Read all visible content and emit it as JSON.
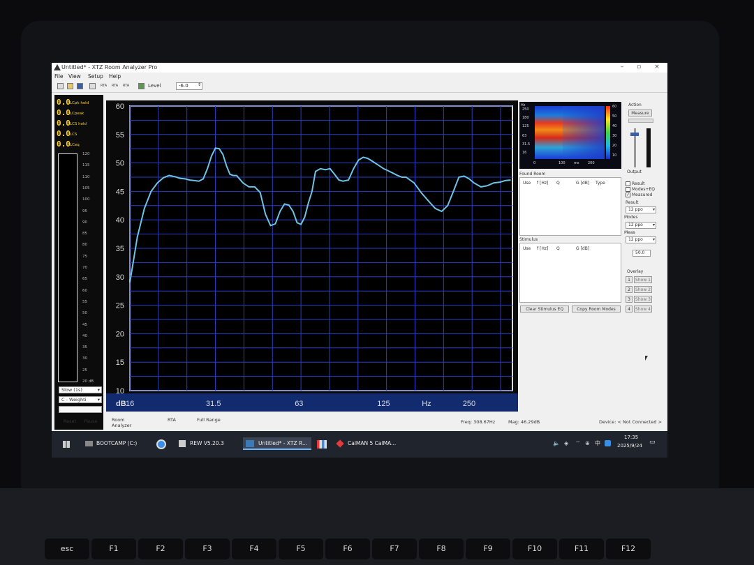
{
  "window": {
    "title": "Untitled* - XTZ Room Analyzer Pro"
  },
  "menu": [
    "File",
    "View",
    "Setup",
    "Help"
  ],
  "toolbar": {
    "level_label": "Level",
    "level_value": "-6.0",
    "small_labels": [
      "RTA",
      "RTA",
      "RTA"
    ]
  },
  "levels": [
    {
      "value": "0.0",
      "label": "LCpk hold"
    },
    {
      "value": "0.0",
      "label": "LCpeak"
    },
    {
      "value": "0.0",
      "label": "LCS hold"
    },
    {
      "value": "0.0",
      "label": "LCS"
    },
    {
      "value": "0.0",
      "label": "LCeq"
    }
  ],
  "meter_scale": [
    "120",
    "115",
    "110",
    "105",
    "100",
    "95",
    "90",
    "85",
    "80",
    "75",
    "70",
    "65",
    "60",
    "55",
    "50",
    "45",
    "40",
    "35",
    "30",
    "25",
    "20 dB"
  ],
  "left_controls": {
    "speed": "Slow (1s)",
    "weighting": "C - Weighti",
    "reset": "Reset",
    "pause": "Pause"
  },
  "chart_data": {
    "type": "line",
    "xscale": "log",
    "xlim": [
      16,
      355
    ],
    "ylim": [
      10,
      60
    ],
    "ylabel": "dB",
    "xlabel": "Hz",
    "yticks": [
      "10",
      "15",
      "20",
      "25",
      "30",
      "35",
      "40",
      "45",
      "50",
      "55",
      "60"
    ],
    "xtick_labels": [
      {
        "label": "16",
        "x": 16
      },
      {
        "label": "31.5",
        "x": 31.5
      },
      {
        "label": "63",
        "x": 63
      },
      {
        "label": "125",
        "x": 125
      },
      {
        "label": "Hz",
        "x": 177
      },
      {
        "label": "250",
        "x": 250
      }
    ],
    "grid": true,
    "series": [
      {
        "color": "#6fc3e6",
        "x": [
          16,
          16.5,
          17,
          18,
          19,
          20,
          21,
          22,
          23,
          24,
          25,
          26,
          27,
          28,
          29,
          30,
          31,
          32,
          33,
          34,
          35,
          36,
          37,
          38,
          40,
          42,
          44,
          46,
          48,
          50,
          52,
          54,
          56,
          58,
          60,
          62,
          64,
          66,
          68,
          70,
          72,
          75,
          78,
          81,
          84,
          87,
          90,
          94,
          98,
          102,
          106,
          110,
          115,
          120,
          125,
          130,
          135,
          140,
          145,
          150,
          160,
          170,
          180,
          190,
          200,
          210,
          220,
          230,
          240,
          250,
          260,
          275,
          290,
          305,
          320,
          335,
          350
        ],
        "y": [
          29,
          33,
          37,
          42,
          45,
          46.5,
          47.4,
          47.8,
          47.6,
          47.3,
          47.2,
          47,
          46.9,
          46.8,
          47.2,
          49,
          51.2,
          52.6,
          52.5,
          51.5,
          49.5,
          48,
          47.8,
          47.8,
          46.5,
          45.8,
          45.8,
          44.8,
          41,
          39,
          39.3,
          41.5,
          42.8,
          42.6,
          41.5,
          39.5,
          39.2,
          40.5,
          43,
          45,
          48.5,
          49,
          48.8,
          49,
          48,
          47,
          46.8,
          47,
          49,
          50.5,
          51,
          50.8,
          50.2,
          49.6,
          49,
          48.6,
          48.2,
          47.8,
          47.5,
          47.5,
          46.5,
          44.7,
          43.3,
          42,
          41.5,
          42.5,
          45,
          47.5,
          47.7,
          47.2,
          46.5,
          45.8,
          46,
          46.5,
          46.6,
          46.9,
          47
        ]
      }
    ]
  },
  "spectrogram": {
    "y_unit": "Hz",
    "y_ticks": [
      "250",
      "180",
      "125",
      "63",
      "31.5",
      "16"
    ],
    "right_ticks": [
      "60",
      "50",
      "40",
      "30",
      "20",
      "10"
    ],
    "x_ticks": [
      "0",
      "100",
      "ms",
      "200"
    ]
  },
  "right_panel": {
    "found_room_title": "Found Room",
    "found_room_cols": [
      "Use",
      "f [Hz]",
      "Q",
      "G [dB]",
      "Type"
    ],
    "stimulus_title": "Stimulus",
    "stimulus_cols": [
      "Use",
      "f [Hz]",
      "Q",
      "G [dB]"
    ],
    "clear_button": "Clear Stimulus EQ",
    "copy_button": "Copy Room Modes"
  },
  "action_panel": {
    "action_title": "Action",
    "measure_button": "Measure",
    "output_title": "Output",
    "checkboxes": [
      {
        "label": "Result",
        "checked": false
      },
      {
        "label": "Modes+EQ",
        "checked": false
      },
      {
        "label": "Measured",
        "checked": true
      }
    ],
    "result_label": "Result",
    "result_value": "12 ppo",
    "modes_label": "Modes",
    "modes_value": "12 ppo",
    "meas_label": "Meas",
    "meas_value": "12 ppo",
    "smooth_value": "50.0",
    "overlay_title": "Overlay",
    "overlays": [
      {
        "num": "1",
        "label": "Show 1"
      },
      {
        "num": "2",
        "label": "Show 2"
      },
      {
        "num": "3",
        "label": "Show 3"
      },
      {
        "num": "4",
        "label": "Show 4"
      }
    ]
  },
  "tabs": [
    "Room Analyzer",
    "RTA",
    "Full Range"
  ],
  "status": {
    "freq": "Freq: 308.67Hz",
    "mag": "Mag: 46.29dB",
    "device": "Device: < Not Connected >"
  },
  "taskbar": {
    "items": [
      "BOOTCAMP (C:)",
      "REW V5.20.3",
      "Untitled* - XTZ R...",
      "CalMAN 5 CalMA..."
    ],
    "time": "17:35",
    "date": "2025/9/24",
    "ime": "中"
  },
  "keyboard": {
    "keys": [
      "esc",
      "F1",
      "F2",
      "F3",
      "F4",
      "F5",
      "F6",
      "F7",
      "F8",
      "F9",
      "F10",
      "F11",
      "F12"
    ]
  }
}
